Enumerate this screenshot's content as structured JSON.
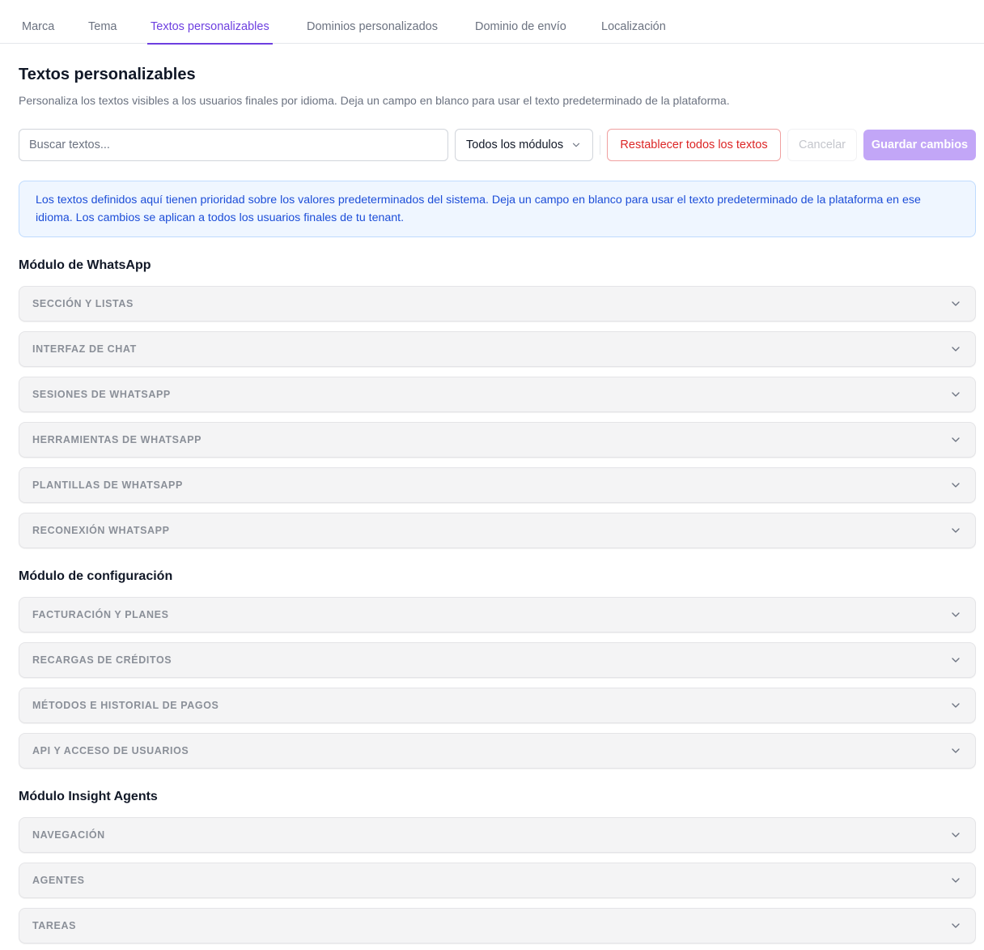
{
  "tabs": [
    {
      "label": "Marca"
    },
    {
      "label": "Tema"
    },
    {
      "label": "Textos personalizables",
      "active": true
    },
    {
      "label": "Dominios personalizados"
    },
    {
      "label": "Dominio de envío"
    },
    {
      "label": "Localización"
    }
  ],
  "header": {
    "title": "Textos personalizables",
    "subtitle": "Personaliza los textos visibles a los usuarios finales por idioma. Deja un campo en blanco para usar el texto predeterminado de la plataforma."
  },
  "toolbar": {
    "search_placeholder": "Buscar textos...",
    "search_value": "",
    "module_select": "Todos los módulos",
    "reset_label": "Restablecer todos los textos",
    "cancel_label": "Cancelar",
    "save_label": "Guardar cambios"
  },
  "info": {
    "text": "Los textos definidos aquí tienen prioridad sobre los valores predeterminados del sistema. Deja un campo en blanco para usar el texto predeterminado de la plataforma en ese idioma. Los cambios se aplican a todos los usuarios finales de tu tenant."
  },
  "sections": [
    {
      "title": "Módulo de WhatsApp",
      "groups": [
        "SECCIÓN Y LISTAS",
        "INTERFAZ DE CHAT",
        "SESIONES DE WHATSAPP",
        "HERRAMIENTAS DE WHATSAPP",
        "PLANTILLAS DE WHATSAPP",
        "RECONEXIÓN WHATSAPP"
      ]
    },
    {
      "title": "Módulo de configuración",
      "groups": [
        "FACTURACIÓN Y PLANES",
        "RECARGAS DE CRÉDITOS",
        "MÉTODOS E HISTORIAL DE PAGOS",
        "API Y ACCESO DE USUARIOS"
      ]
    },
    {
      "title": "Módulo Insight Agents",
      "groups": [
        "NAVEGACIÓN",
        "AGENTES",
        "TAREAS"
      ]
    }
  ],
  "icons": {
    "accordion": "chevron-down-icon",
    "select": "chevron-down-icon"
  },
  "colors": {
    "accent": "#6d3fe0",
    "danger": "#dc2626",
    "save_button": "#c2a6f7",
    "info_text": "#1d4ed8",
    "info_bg": "#eff6ff"
  }
}
